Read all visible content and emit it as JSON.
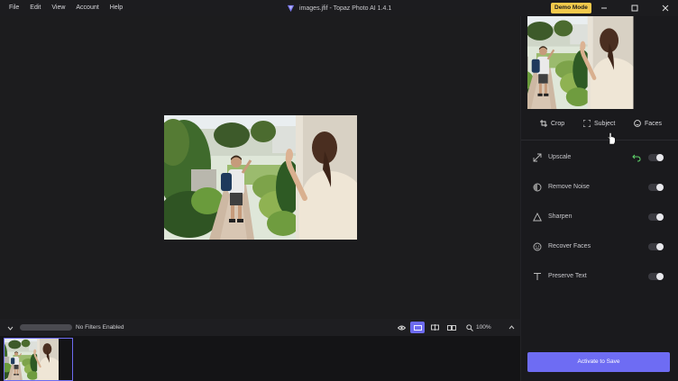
{
  "menu": {
    "items": [
      "File",
      "Edit",
      "View",
      "Account",
      "Help"
    ]
  },
  "window": {
    "title": "images.jfif - Topaz Photo AI 1.4.1",
    "demo_badge": "Demo Mode"
  },
  "bottom_bar": {
    "filter_status": "No Filters Enabled",
    "zoom_level": "100%"
  },
  "panel": {
    "tabs": [
      {
        "label": "Crop",
        "icon": "crop-icon"
      },
      {
        "label": "Subject",
        "icon": "subject-icon"
      },
      {
        "label": "Faces",
        "icon": "faces-icon"
      }
    ],
    "filters": [
      {
        "label": "Upscale",
        "icon": "upscale-icon",
        "enabled": false,
        "has_undo": true
      },
      {
        "label": "Remove Noise",
        "icon": "remove-noise-icon",
        "enabled": false
      },
      {
        "label": "Sharpen",
        "icon": "sharpen-icon",
        "enabled": false
      },
      {
        "label": "Recover Faces",
        "icon": "recover-faces-icon",
        "enabled": false
      },
      {
        "label": "Preserve Text",
        "icon": "preserve-text-icon",
        "enabled": false
      }
    ],
    "activate_label": "Activate to Save"
  },
  "colors": {
    "accent": "#6e6cf3",
    "demo_badge": "#f2c94c",
    "undo": "#5fd36b"
  }
}
